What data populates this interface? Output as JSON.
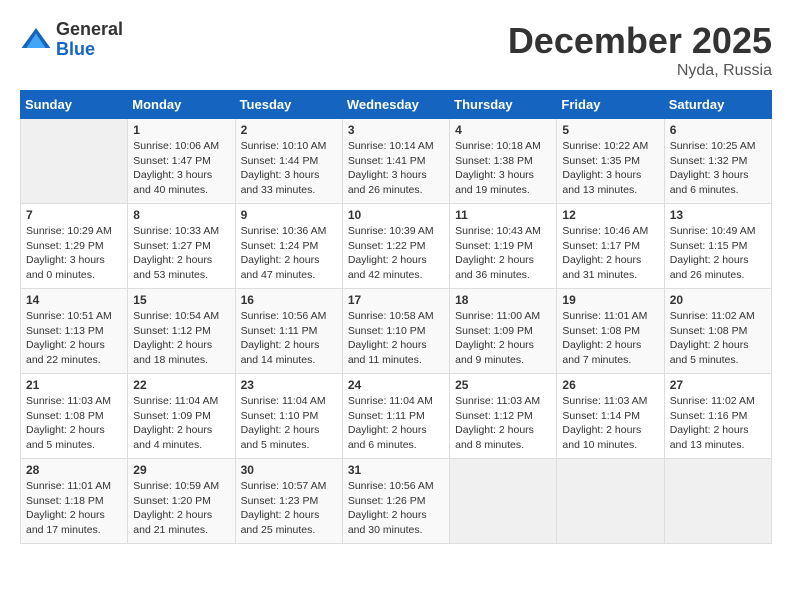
{
  "logo": {
    "general": "General",
    "blue": "Blue"
  },
  "header": {
    "month": "December 2025",
    "location": "Nyda, Russia"
  },
  "weekdays": [
    "Sunday",
    "Monday",
    "Tuesday",
    "Wednesday",
    "Thursday",
    "Friday",
    "Saturday"
  ],
  "weeks": [
    [
      {
        "day": "",
        "info": ""
      },
      {
        "day": "1",
        "info": "Sunrise: 10:06 AM\nSunset: 1:47 PM\nDaylight: 3 hours\nand 40 minutes."
      },
      {
        "day": "2",
        "info": "Sunrise: 10:10 AM\nSunset: 1:44 PM\nDaylight: 3 hours\nand 33 minutes."
      },
      {
        "day": "3",
        "info": "Sunrise: 10:14 AM\nSunset: 1:41 PM\nDaylight: 3 hours\nand 26 minutes."
      },
      {
        "day": "4",
        "info": "Sunrise: 10:18 AM\nSunset: 1:38 PM\nDaylight: 3 hours\nand 19 minutes."
      },
      {
        "day": "5",
        "info": "Sunrise: 10:22 AM\nSunset: 1:35 PM\nDaylight: 3 hours\nand 13 minutes."
      },
      {
        "day": "6",
        "info": "Sunrise: 10:25 AM\nSunset: 1:32 PM\nDaylight: 3 hours\nand 6 minutes."
      }
    ],
    [
      {
        "day": "7",
        "info": "Sunrise: 10:29 AM\nSunset: 1:29 PM\nDaylight: 3 hours\nand 0 minutes."
      },
      {
        "day": "8",
        "info": "Sunrise: 10:33 AM\nSunset: 1:27 PM\nDaylight: 2 hours\nand 53 minutes."
      },
      {
        "day": "9",
        "info": "Sunrise: 10:36 AM\nSunset: 1:24 PM\nDaylight: 2 hours\nand 47 minutes."
      },
      {
        "day": "10",
        "info": "Sunrise: 10:39 AM\nSunset: 1:22 PM\nDaylight: 2 hours\nand 42 minutes."
      },
      {
        "day": "11",
        "info": "Sunrise: 10:43 AM\nSunset: 1:19 PM\nDaylight: 2 hours\nand 36 minutes."
      },
      {
        "day": "12",
        "info": "Sunrise: 10:46 AM\nSunset: 1:17 PM\nDaylight: 2 hours\nand 31 minutes."
      },
      {
        "day": "13",
        "info": "Sunrise: 10:49 AM\nSunset: 1:15 PM\nDaylight: 2 hours\nand 26 minutes."
      }
    ],
    [
      {
        "day": "14",
        "info": "Sunrise: 10:51 AM\nSunset: 1:13 PM\nDaylight: 2 hours\nand 22 minutes."
      },
      {
        "day": "15",
        "info": "Sunrise: 10:54 AM\nSunset: 1:12 PM\nDaylight: 2 hours\nand 18 minutes."
      },
      {
        "day": "16",
        "info": "Sunrise: 10:56 AM\nSunset: 1:11 PM\nDaylight: 2 hours\nand 14 minutes."
      },
      {
        "day": "17",
        "info": "Sunrise: 10:58 AM\nSunset: 1:10 PM\nDaylight: 2 hours\nand 11 minutes."
      },
      {
        "day": "18",
        "info": "Sunrise: 11:00 AM\nSunset: 1:09 PM\nDaylight: 2 hours\nand 9 minutes."
      },
      {
        "day": "19",
        "info": "Sunrise: 11:01 AM\nSunset: 1:08 PM\nDaylight: 2 hours\nand 7 minutes."
      },
      {
        "day": "20",
        "info": "Sunrise: 11:02 AM\nSunset: 1:08 PM\nDaylight: 2 hours\nand 5 minutes."
      }
    ],
    [
      {
        "day": "21",
        "info": "Sunrise: 11:03 AM\nSunset: 1:08 PM\nDaylight: 2 hours\nand 5 minutes."
      },
      {
        "day": "22",
        "info": "Sunrise: 11:04 AM\nSunset: 1:09 PM\nDaylight: 2 hours\nand 4 minutes."
      },
      {
        "day": "23",
        "info": "Sunrise: 11:04 AM\nSunset: 1:10 PM\nDaylight: 2 hours\nand 5 minutes."
      },
      {
        "day": "24",
        "info": "Sunrise: 11:04 AM\nSunset: 1:11 PM\nDaylight: 2 hours\nand 6 minutes."
      },
      {
        "day": "25",
        "info": "Sunrise: 11:03 AM\nSunset: 1:12 PM\nDaylight: 2 hours\nand 8 minutes."
      },
      {
        "day": "26",
        "info": "Sunrise: 11:03 AM\nSunset: 1:14 PM\nDaylight: 2 hours\nand 10 minutes."
      },
      {
        "day": "27",
        "info": "Sunrise: 11:02 AM\nSunset: 1:16 PM\nDaylight: 2 hours\nand 13 minutes."
      }
    ],
    [
      {
        "day": "28",
        "info": "Sunrise: 11:01 AM\nSunset: 1:18 PM\nDaylight: 2 hours\nand 17 minutes."
      },
      {
        "day": "29",
        "info": "Sunrise: 10:59 AM\nSunset: 1:20 PM\nDaylight: 2 hours\nand 21 minutes."
      },
      {
        "day": "30",
        "info": "Sunrise: 10:57 AM\nSunset: 1:23 PM\nDaylight: 2 hours\nand 25 minutes."
      },
      {
        "day": "31",
        "info": "Sunrise: 10:56 AM\nSunset: 1:26 PM\nDaylight: 2 hours\nand 30 minutes."
      },
      {
        "day": "",
        "info": ""
      },
      {
        "day": "",
        "info": ""
      },
      {
        "day": "",
        "info": ""
      }
    ]
  ]
}
